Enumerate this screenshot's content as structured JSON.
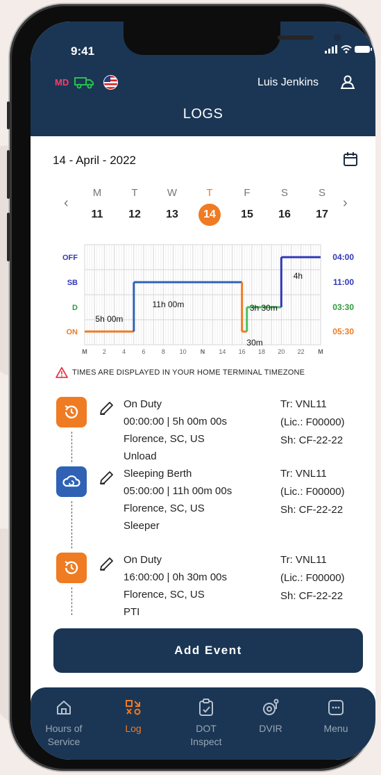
{
  "status_bar": {
    "time": "9:41"
  },
  "header": {
    "md_label": "MD",
    "user_name": "Luis Jenkins",
    "title": "LOGS"
  },
  "date": "14 - April - 2022",
  "week": [
    {
      "name": "M",
      "num": "11"
    },
    {
      "name": "T",
      "num": "12"
    },
    {
      "name": "W",
      "num": "13"
    },
    {
      "name": "T",
      "num": "14",
      "active": true
    },
    {
      "name": "F",
      "num": "15"
    },
    {
      "name": "S",
      "num": "16"
    },
    {
      "name": "S",
      "num": "17"
    }
  ],
  "chart_data": {
    "type": "line",
    "rows": [
      "OFF",
      "SB",
      "D",
      "ON"
    ],
    "row_colors": {
      "OFF": "#3038b8",
      "SB": "#3038b8",
      "D": "#2e9b3a",
      "ON": "#ef7b22"
    },
    "row_totals": [
      "04:00",
      "11:00",
      "03:30",
      "05:30"
    ],
    "x_ticks": [
      "M",
      "2",
      "4",
      "6",
      "8",
      "10",
      "N",
      "14",
      "16",
      "18",
      "20",
      "22",
      "M"
    ],
    "xlim": [
      0,
      24
    ],
    "segments": [
      {
        "status": "ON",
        "start": 0,
        "end": 5,
        "color": "#ef7b22",
        "label": "5h 00m"
      },
      {
        "status": "SB",
        "start": 5,
        "end": 16,
        "color": "#2f62b5",
        "label": "11h 00m"
      },
      {
        "status": "ON",
        "start": 16,
        "end": 16.5,
        "color": "#ef7b22",
        "label": "30m"
      },
      {
        "status": "D",
        "start": 16.5,
        "end": 20,
        "color": "#47c05c",
        "label": "3h 30m"
      },
      {
        "status": "OFF",
        "start": 20,
        "end": 24,
        "color": "#3038b8",
        "label": "4h"
      }
    ]
  },
  "warning": "TIMES ARE DISPLAYED IN YOUR HOME TERMINAL TIMEZONE",
  "events": [
    {
      "type": "On Duty",
      "time": "00:00:00  | 5h 00m 00s",
      "location": "Florence, SC, US",
      "note": "Unload",
      "truck": "Tr: VNL11",
      "license": "(Lic.: F00000)",
      "shipment": "Sh: CF-22-22",
      "icon": "on-duty-icon",
      "color": "#ef7b22"
    },
    {
      "type": "Sleeping Berth",
      "time": "05:00:00 | 11h 00m 00s",
      "location": "Florence, SC, US",
      "note": "Sleeper",
      "truck": "Tr: VNL11",
      "license": "(Lic.: F00000)",
      "shipment": "Sh: CF-22-22",
      "icon": "sleeping-berth-icon",
      "color": "#2f62b5"
    },
    {
      "type": "On Duty",
      "time": "16:00:00  | 0h 30m 00s",
      "location": "Florence, SC, US",
      "note": "PTI",
      "truck": "Tr: VNL11",
      "license": "(Lic.: F00000)",
      "shipment": "Sh: CF-22-22",
      "icon": "on-duty-icon",
      "color": "#ef7b22"
    }
  ],
  "add_event_label": "Add Event",
  "tabs": [
    {
      "label": "Hours of\nService",
      "icon": "home-icon"
    },
    {
      "label": "Log",
      "icon": "log-icon",
      "active": true
    },
    {
      "label": "DOT\nInspect",
      "icon": "clipboard-icon"
    },
    {
      "label": "DVIR",
      "icon": "dvir-icon"
    },
    {
      "label": "Menu",
      "icon": "menu-icon"
    }
  ]
}
